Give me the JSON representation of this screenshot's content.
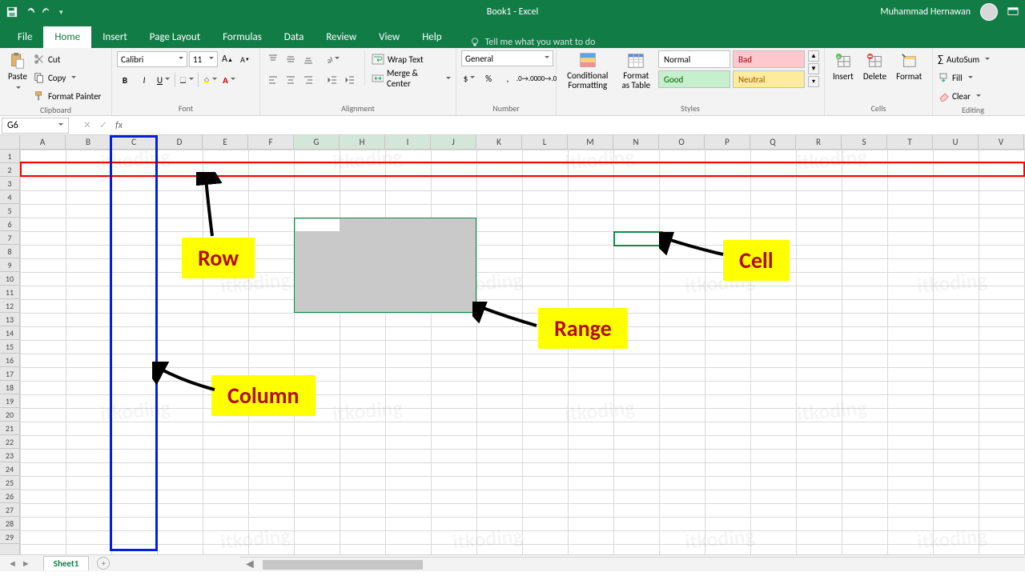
{
  "titlebar": {
    "doc_title": "Book1  -  Excel",
    "user_name": "Muhammad Hernawan"
  },
  "tabs": {
    "file": "File",
    "home": "Home",
    "insert": "Insert",
    "page_layout": "Page Layout",
    "formulas": "Formulas",
    "data": "Data",
    "review": "Review",
    "view": "View",
    "help": "Help",
    "tell_me": "Tell me what you want to do"
  },
  "ribbon": {
    "clipboard": {
      "paste": "Paste",
      "cut": "Cut",
      "copy": "Copy",
      "format_painter": "Format Painter",
      "label": "Clipboard"
    },
    "font": {
      "name": "Calibri",
      "size": "11",
      "label": "Font"
    },
    "alignment": {
      "wrap": "Wrap Text",
      "merge": "Merge & Center",
      "label": "Alignment"
    },
    "number": {
      "format": "General",
      "label": "Number"
    },
    "styles": {
      "cond_fmt": "Conditional Formatting",
      "fmt_table": "Format as Table",
      "normal": "Normal",
      "bad": "Bad",
      "good": "Good",
      "neutral": "Neutral",
      "label": "Styles"
    },
    "cells": {
      "insert": "Insert",
      "delete": "Delete",
      "format": "Format",
      "label": "Cells"
    },
    "editing": {
      "autosum": "AutoSum",
      "fill": "Fill",
      "clear": "Clear",
      "label": "Editing"
    }
  },
  "formula_bar": {
    "name_box": "G6"
  },
  "columns": [
    "A",
    "B",
    "C",
    "D",
    "E",
    "F",
    "G",
    "H",
    "I",
    "J",
    "K",
    "L",
    "M",
    "N",
    "O",
    "P",
    "Q",
    "R",
    "S",
    "T",
    "U",
    "V"
  ],
  "rows": [
    "1",
    "2",
    "3",
    "4",
    "5",
    "6",
    "7",
    "8",
    "9",
    "10",
    "11",
    "12",
    "13",
    "14",
    "15",
    "16",
    "17",
    "18",
    "19",
    "20",
    "21",
    "22",
    "23",
    "24",
    "25",
    "26",
    "27",
    "28",
    "29"
  ],
  "annotations": {
    "row": "Row",
    "column": "Column",
    "range": "Range",
    "cell": "Cell"
  },
  "sheet": {
    "name": "Sheet1"
  },
  "watermark": "itkoding"
}
